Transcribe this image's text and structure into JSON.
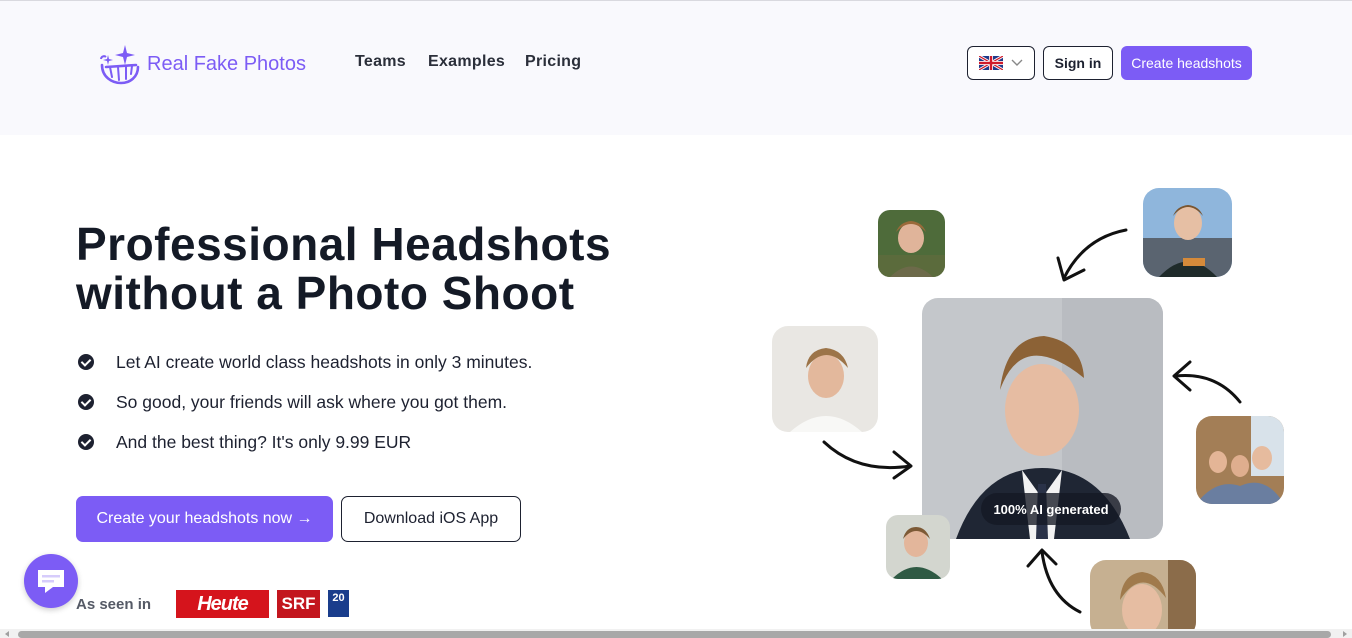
{
  "brand": {
    "name": "Real Fake Photos",
    "color": "#7c5cf5"
  },
  "nav": {
    "items": [
      "Teams",
      "Examples",
      "Pricing"
    ]
  },
  "header": {
    "language_icon": "uk-flag-icon",
    "sign_in_label": "Sign in",
    "create_label": "Create headshots"
  },
  "hero": {
    "title_line1": "Professional Headshots",
    "title_line2": "without a Photo Shoot",
    "bullets": [
      "Let AI create world class headshots in only 3 minutes.",
      "So good, your friends will ask where you got them.",
      "And the best thing? It's only 9.99 EUR"
    ],
    "cta_primary": "Create your headshots now →",
    "cta_secondary": "Download iOS App"
  },
  "press": {
    "label": "As seen in",
    "logos": [
      "Heute",
      "SRF",
      "20"
    ]
  },
  "showcase": {
    "badge": "100% AI generated"
  },
  "chat": {
    "icon": "chat-icon"
  }
}
